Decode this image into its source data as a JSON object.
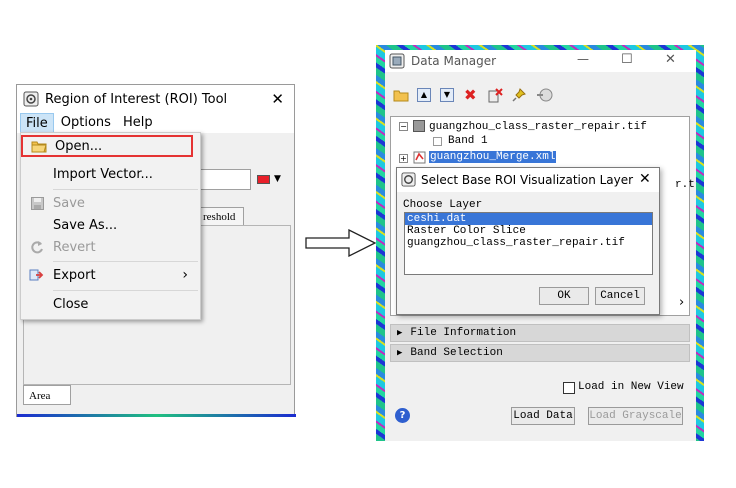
{
  "roi_tool": {
    "title": "Region of Interest (ROI) Tool",
    "close_glyph": "✕",
    "menu": [
      "File",
      "Options",
      "Help"
    ],
    "file_menu": {
      "open": "Open...",
      "import_vector": "Import Vector...",
      "save": "Save",
      "save_as": "Save As...",
      "revert": "Revert",
      "export": "Export",
      "close": "Close",
      "submenu_arrow": "›"
    },
    "partial_tab_label": "reshold",
    "bottom_tab": "Area",
    "color_swatch": "#e8202a"
  },
  "arrow_icon": "right-arrow-icon",
  "data_manager": {
    "title": "Data Manager",
    "window_controls": [
      "—",
      "☐",
      "✕"
    ],
    "tree": {
      "file1": "guangzhou_class_raster_repair.tif",
      "band1": "Band 1",
      "file2": "guangzhou_Merge.xml",
      "file2_truncated": "r.t"
    },
    "sections": [
      "File Information",
      "Band Selection"
    ],
    "load_in_new_view": "Load in New View",
    "load_data": "Load Data",
    "load_grayscale": "Load Grayscale",
    "scroll_arrow": "›"
  },
  "dialog": {
    "title": "Select Base ROI Visualization Layer",
    "label": "Choose Layer",
    "layers": [
      "ceshi.dat",
      "Raster Color Slice",
      "guangzhou_class_raster_repair.tif"
    ],
    "ok": "OK",
    "cancel": "Cancel",
    "close_glyph": "✕"
  }
}
